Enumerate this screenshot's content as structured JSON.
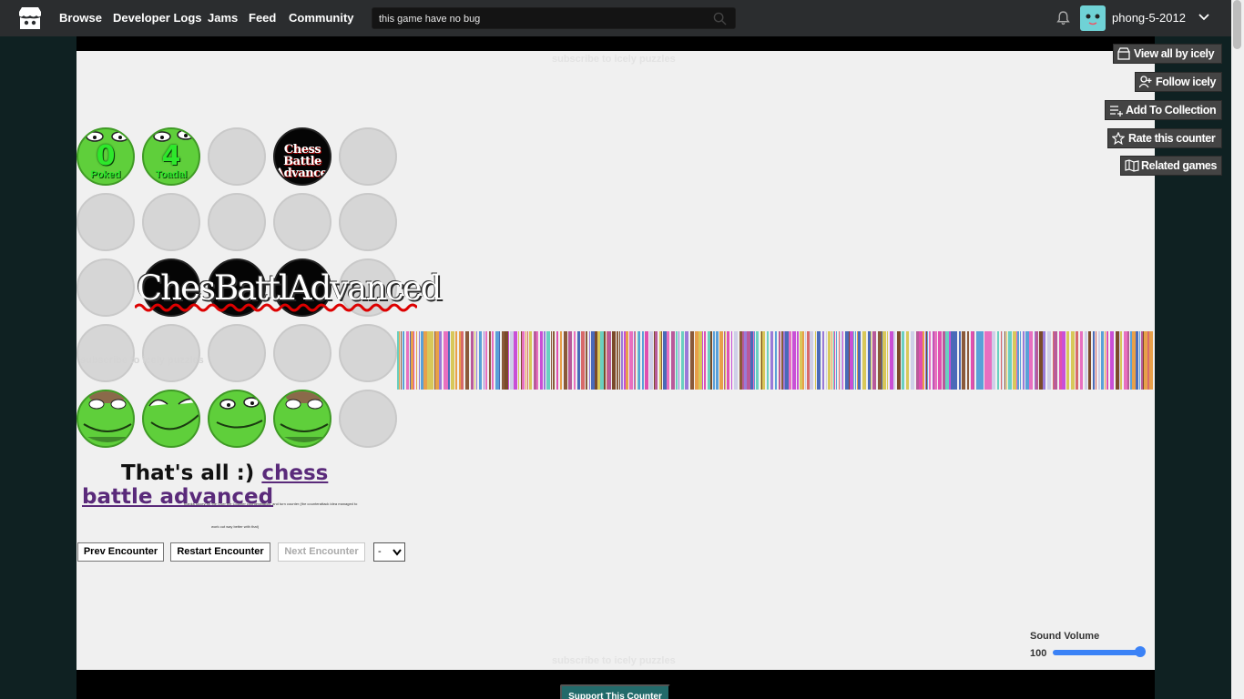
{
  "nav": {
    "links": [
      "Browse",
      "Developer Logs",
      "Jams",
      "Feed",
      "Community"
    ],
    "search_value": "this game have no bug",
    "username": "phong-5-2012"
  },
  "side_buttons": [
    "View all by icely",
    "Follow icely",
    "Add To Collection",
    "Rate this counter",
    "Related games"
  ],
  "game": {
    "watermark_top": "subscribe to icely puzzles",
    "watermark_mid": "subscribe to icely puzzles",
    "watermark_bottom": "subscribe to icely puzzles",
    "counter_poked": {
      "value": "0",
      "label": "Poked"
    },
    "counter_toadal": {
      "value": "4",
      "label": "Toadal"
    },
    "chess_small": "Chess Battle Advanced",
    "chess_big": "ChesBattlAdvanced",
    "message_prefix": "That's all :)",
    "message_link": "chess battle advanced",
    "tiny_line1": "thanks sooey for the Over the Counter counterattacks, and turn counter (the counterattack idea managed to",
    "tiny_line2": "work out way better with that)",
    "buttons": {
      "prev": "Prev Encounter",
      "restart": "Restart Encounter",
      "next": "Next Encounter"
    },
    "select_value": "-",
    "sound_volume_label": "Sound Volume",
    "sound_volume_value": "100",
    "sound_volume_level": 1.0
  },
  "support_label": "Support This Counter",
  "colors": {
    "topbar": "#2b2d2f",
    "page_bg": "#0f2122",
    "game_bg": "#f0f0f0",
    "link_purple": "#5a2a7a",
    "slider_blue": "#3b82f6",
    "support_teal": "#226a6a"
  }
}
